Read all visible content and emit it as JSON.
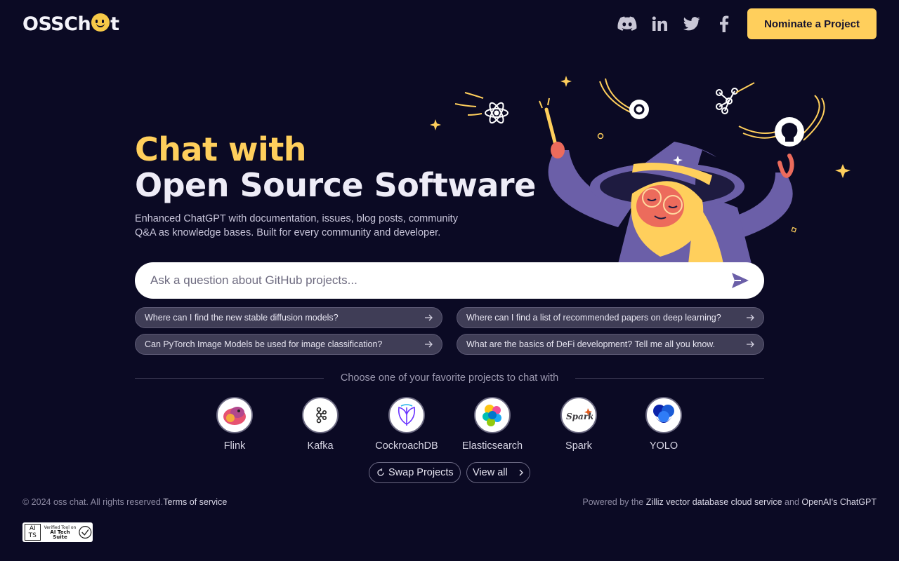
{
  "header": {
    "logo_text_a": "OSSCh",
    "logo_text_b": "t",
    "social": [
      "discord-icon",
      "linkedin-icon",
      "twitter-icon",
      "facebook-icon"
    ],
    "nominate_label": "Nominate a Project"
  },
  "hero": {
    "title_line1": "Chat with",
    "title_line2": "Open Source Software",
    "subtitle": "Enhanced ChatGPT with documentation, issues, blog posts, community Q&A as knowledge bases. Built for every community and developer."
  },
  "search": {
    "placeholder": "Ask a question about GitHub projects..."
  },
  "suggestions": [
    "Where can I find the new stable diffusion models?",
    "Where can I find a list of recommended papers on deep learning?",
    "Can PyTorch Image Models be used for image classification?",
    "What are the basics of DeFi development? Tell me all you know."
  ],
  "projects_heading": "Choose one of your favorite projects to chat with",
  "projects": [
    {
      "name": "Flink",
      "icon": "flink-logo-icon"
    },
    {
      "name": "Kafka",
      "icon": "kafka-logo-icon"
    },
    {
      "name": "CockroachDB",
      "icon": "cockroachdb-logo-icon"
    },
    {
      "name": "Elasticsearch",
      "icon": "elasticsearch-logo-icon"
    },
    {
      "name": "Spark",
      "icon": "spark-logo-icon"
    },
    {
      "name": "YOLO",
      "icon": "yolo-logo-icon"
    }
  ],
  "actions": {
    "swap_label": "Swap Projects",
    "view_all_label": "View all"
  },
  "footer": {
    "copyright": "© 2024 oss chat. All rights reserved.",
    "terms": "Terms of service",
    "powered_prefix": "Powered by the ",
    "zilliz_link": "Zilliz vector database cloud service",
    "and": " and ",
    "openai_link": "OpenAI's ChatGPT",
    "badge_box": "AI TS",
    "badge_small": "Verified Tool on",
    "badge_big": "AI Tech Suite"
  },
  "colors": {
    "background": "#0b0a24",
    "accent": "#ffcf5c",
    "wizard_purple": "#6b5fa8"
  }
}
